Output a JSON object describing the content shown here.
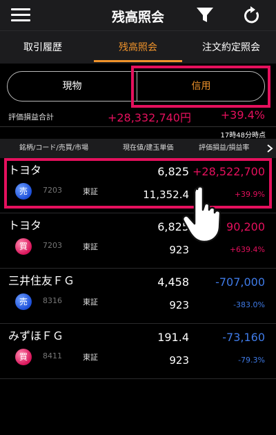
{
  "header": {
    "title": "残高照会"
  },
  "tabs": [
    "取引履歴",
    "残高照会",
    "注文約定照会"
  ],
  "segment": {
    "left": "現物",
    "right": "信用"
  },
  "summary": {
    "label": "評価損益合計",
    "value": "+28,332,740円",
    "rate": "+39.4%",
    "timestamp": "17時48分時点"
  },
  "columns": [
    "銘柄/コード/売買/市場",
    "現在値/建玉単価",
    "評価損益/損益率"
  ],
  "rows": [
    {
      "name": "トヨタ",
      "side": "売",
      "code": "7203",
      "market": "東証",
      "price": "6,825",
      "unit_price": "11,352.4",
      "pl": "+28,522,700",
      "pl_rate": "+39.9%"
    },
    {
      "name": "トヨタ",
      "side": "買",
      "code": "7203",
      "market": "東証",
      "price": "6,825",
      "unit_price": "923",
      "pl": "90,200",
      "pl_rate": "+639.4%"
    },
    {
      "name": "三井住友ＦＧ",
      "side": "売",
      "code": "8316",
      "market": "東証",
      "price": "4,458",
      "unit_price": "923",
      "pl": "-707,000",
      "pl_rate": "-383.0%"
    },
    {
      "name": "みずほＦＧ",
      "side": "買",
      "code": "8411",
      "market": "東証",
      "price": "191.4",
      "unit_price": "923",
      "pl": "-73,160",
      "pl_rate": "-79.3%"
    }
  ],
  "colors": {
    "accent": "#f0932b",
    "positive": "#e5105d",
    "negative": "#3f7be8",
    "highlight": "#e5105d"
  }
}
